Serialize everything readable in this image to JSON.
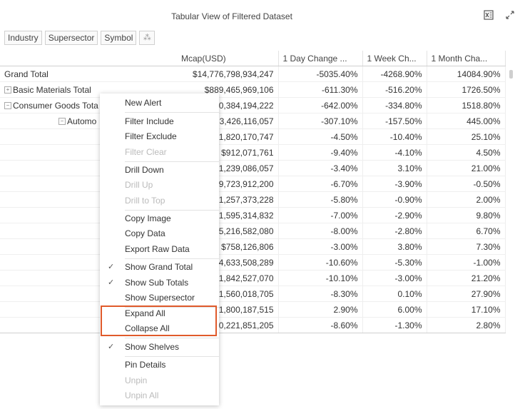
{
  "title": "Tabular View of Filtered Dataset",
  "toolbar": {
    "excel_icon": "excel-export-icon",
    "expand_icon": "expand-icon"
  },
  "shelves": [
    "Industry",
    "Supersector",
    "Symbol"
  ],
  "columns": [
    "Mcap(USD)",
    "1 Day Change ...",
    "1 Week Ch...",
    "1 Month Cha..."
  ],
  "rows": [
    {
      "label": "Grand Total",
      "values": [
        "$14,776,798,934,247",
        "-5035.40%",
        "-4268.90%",
        "14084.90%"
      ]
    },
    {
      "label": "Basic Materials Total",
      "values": [
        "$889,465,969,106",
        "-611.30%",
        "-516.20%",
        "1726.50%"
      ]
    },
    {
      "label": "Consumer Goods Tota",
      "values": [
        ",0,384,194,222",
        "-642.00%",
        "-334.80%",
        "1518.80%"
      ]
    },
    {
      "label": "Automo",
      "values": [
        "3,426,116,057",
        "-307.10%",
        "-157.50%",
        "445.00%"
      ]
    },
    {
      "label": "",
      "values": [
        "1,820,170,747",
        "-4.50%",
        "-10.40%",
        "25.10%"
      ]
    },
    {
      "label": "",
      "values": [
        "$912,071,761",
        "-9.40%",
        "-4.10%",
        "4.50%"
      ]
    },
    {
      "label": "",
      "values": [
        "1,239,086,057",
        "-3.40%",
        "3.10%",
        "21.00%"
      ]
    },
    {
      "label": "",
      "values": [
        ",9,723,912,200",
        "-6.70%",
        "-3.90%",
        "-0.50%"
      ]
    },
    {
      "label": "",
      "values": [
        "1,257,373,228",
        "-5.80%",
        "-0.90%",
        "2.00%"
      ]
    },
    {
      "label": "",
      "values": [
        "1,595,314,832",
        "-7.00%",
        "-2.90%",
        "9.80%"
      ]
    },
    {
      "label": "",
      "values": [
        ",5,216,582,080",
        "-8.00%",
        "-2.80%",
        "6.70%"
      ]
    },
    {
      "label": "",
      "values": [
        "$758,126,806",
        "-3.00%",
        "3.80%",
        "7.30%"
      ]
    },
    {
      "label": "",
      "values": [
        "4,633,508,289",
        "-10.60%",
        "-5.30%",
        "-1.00%"
      ]
    },
    {
      "label": "",
      "values": [
        "1,842,527,070",
        "-10.10%",
        "-3.00%",
        "21.20%"
      ]
    },
    {
      "label": "",
      "values": [
        "1,560,018,705",
        "-8.30%",
        "0.10%",
        "27.90%"
      ]
    },
    {
      "label": "",
      "values": [
        "1,800,187,515",
        "2.90%",
        "6.00%",
        "17.10%"
      ]
    },
    {
      "label": "",
      "values": [
        ",0,221,851,205",
        "-8.60%",
        "-1.30%",
        "2.80%"
      ]
    }
  ],
  "menu": {
    "new_alert": "New Alert",
    "filter_include": "Filter Include",
    "filter_exclude": "Filter Exclude",
    "filter_clear": "Filter Clear",
    "drill_down": "Drill Down",
    "drill_up": "Drill Up",
    "drill_to_top": "Drill to Top",
    "copy_image": "Copy Image",
    "copy_data": "Copy Data",
    "export_raw_data": "Export Raw Data",
    "show_grand_total": "Show Grand Total",
    "show_sub_totals": "Show Sub Totals",
    "show_supersector": "Show Supersector",
    "expand_all": "Expand All",
    "collapse_all": "Collapse All",
    "show_shelves": "Show Shelves",
    "pin_details": "Pin Details",
    "unpin": "Unpin",
    "unpin_all": "Unpin All",
    "check_glyph": "✓"
  },
  "colors": {
    "highlight": "#e05a2b",
    "disabled_text": "#bbbbbb"
  }
}
